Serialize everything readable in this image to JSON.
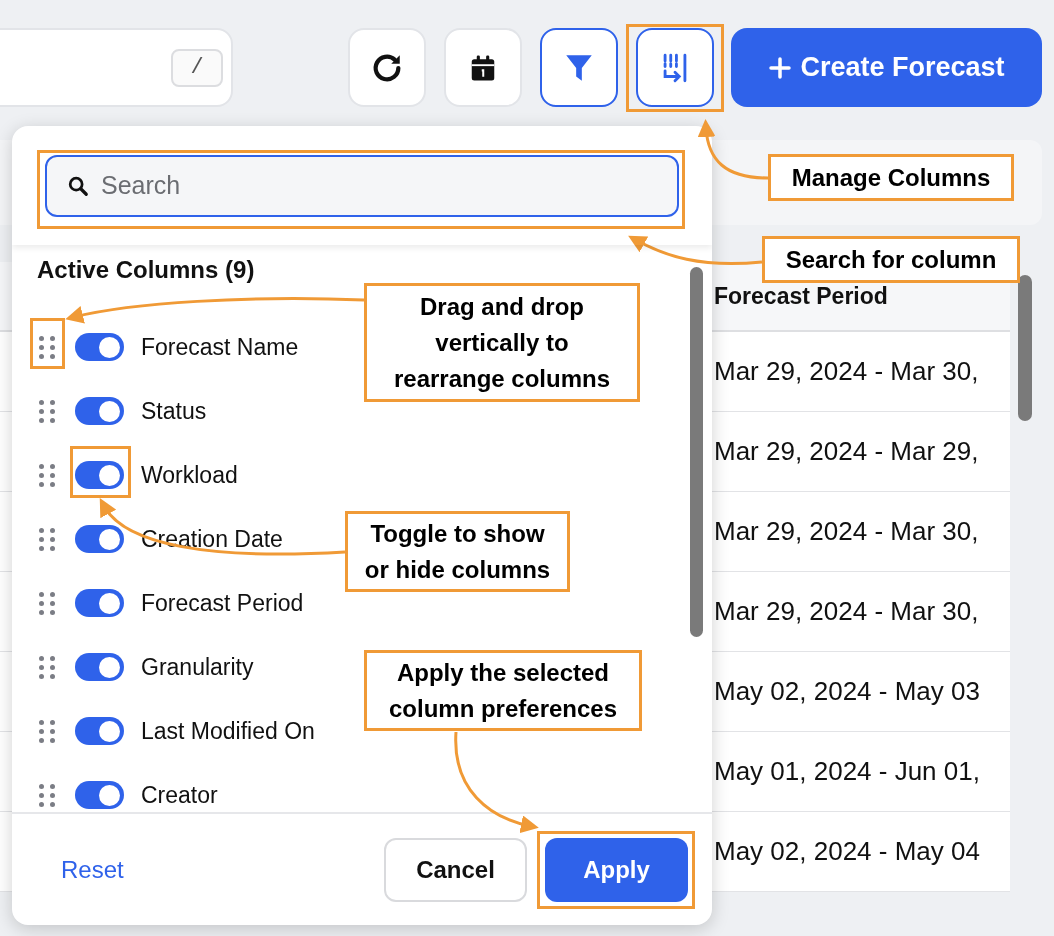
{
  "toolbar": {
    "search_shortcut": "/",
    "buttons": [
      {
        "kind": "refresh",
        "selected": false
      },
      {
        "kind": "calendar",
        "selected": false
      },
      {
        "kind": "filter",
        "selected": true
      },
      {
        "kind": "columns",
        "selected": true
      }
    ],
    "create_button": "Create Forecast"
  },
  "table": {
    "header": "Forecast Period",
    "rows": [
      {
        "period": "Mar 29, 2024 - Mar 30,"
      },
      {
        "period": "Mar 29, 2024 - Mar 29,"
      },
      {
        "period": "Mar 29, 2024 - Mar 30,"
      },
      {
        "period": "Mar 29, 2024 - Mar 30,"
      },
      {
        "period": "May 02, 2024 - May 03"
      },
      {
        "period": "May 01, 2024 - Jun 01,"
      },
      {
        "period": "May 02, 2024 - May 04"
      }
    ]
  },
  "column_panel": {
    "search": {
      "placeholder": "Search"
    },
    "heading": "Active Columns (9)",
    "items": [
      {
        "label": "Forecast Name",
        "on": true
      },
      {
        "label": "Status",
        "on": true
      },
      {
        "label": "Workload",
        "on": true
      },
      {
        "label": "Creation Date",
        "on": true
      },
      {
        "label": "Forecast Period",
        "on": true
      },
      {
        "label": "Granularity",
        "on": true
      },
      {
        "label": "Last Modified On",
        "on": true
      },
      {
        "label": "Creator",
        "on": true
      }
    ],
    "reset": "Reset",
    "cancel": "Cancel",
    "apply": "Apply"
  },
  "annotations": [
    {
      "kind": "manage",
      "text": "Manage Columns"
    },
    {
      "kind": "search",
      "text": "Search for column"
    },
    {
      "kind": "drag",
      "text": "Drag and drop vertically to rearrange columns"
    },
    {
      "kind": "toggle",
      "text": "Toggle to show or hide columns"
    },
    {
      "kind": "apply",
      "text": "Apply the selected column preferences"
    }
  ]
}
